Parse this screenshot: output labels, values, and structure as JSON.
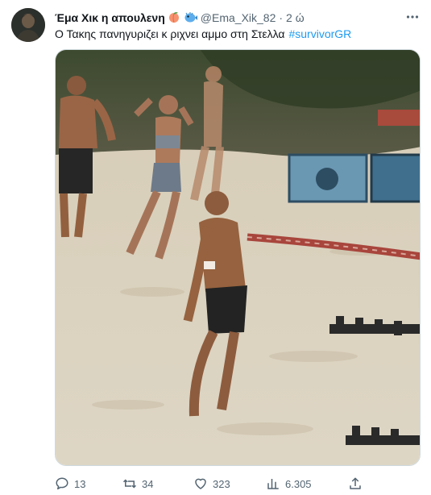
{
  "tweet": {
    "author": {
      "display_name": "Έμα Χικ η απουλενη",
      "emojis": [
        "peach-emoji",
        "blowfish-emoji"
      ],
      "handle": "@Ema_Xik_82",
      "separator": "·",
      "time": "2 ώ"
    },
    "text": "Ο Τακης πανηγυριζει κ ριχνει αμμο στη Στελλα",
    "hashtag": "#survivorGR",
    "media": {
      "type": "video-still",
      "description_icon": "beach-scene-image"
    },
    "actions": {
      "replies": "13",
      "retweets": "34",
      "likes": "323",
      "views": "6.305"
    }
  },
  "colors": {
    "accent": "#1d9bf0",
    "text": "#0f1419",
    "muted": "#536471",
    "border": "#cfd9de"
  },
  "icons": {
    "more": "more-dots-icon",
    "reply": "reply-icon",
    "retweet": "retweet-icon",
    "like": "heart-icon",
    "views": "views-chart-icon",
    "share": "share-icon"
  }
}
